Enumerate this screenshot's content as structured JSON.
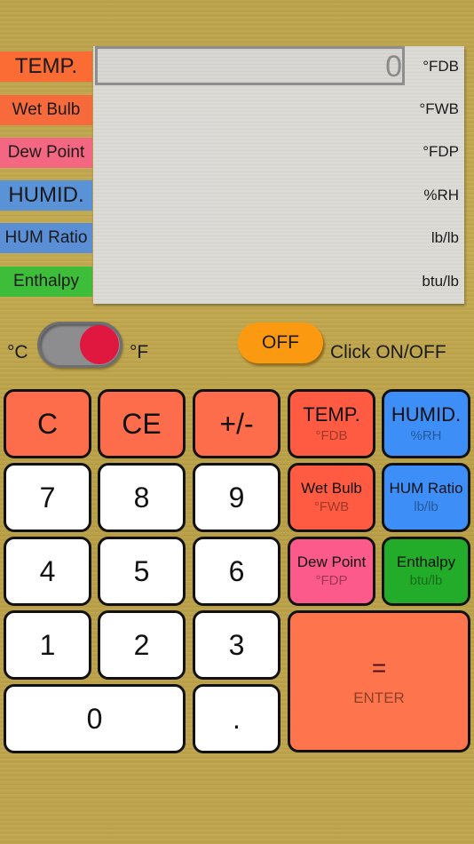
{
  "labels": [
    {
      "text": "TEMP.",
      "color": "#fb6b34"
    },
    {
      "text": "Wet Bulb",
      "color": "#f66a3c"
    },
    {
      "text": "Dew Point",
      "color": "#f46782"
    },
    {
      "text": "HUMID.",
      "color": "#5a92d8"
    },
    {
      "text": "HUM Ratio",
      "color": "#5a8fd6"
    },
    {
      "text": "Enthalpy",
      "color": "#3ebd3a"
    }
  ],
  "display": {
    "input_value": "0",
    "units": [
      "°FDB",
      "°FWB",
      "°FDP",
      "%RH",
      "lb/lb",
      "btu/lb"
    ]
  },
  "controls": {
    "celsius_label": "°C",
    "fahrenheit_label": "°F",
    "unit_toggle_state": "F",
    "power_button_label": "OFF",
    "power_hint": "Click ON/OFF"
  },
  "keypad": {
    "clear": "C",
    "clear_entry": "CE",
    "sign": "+/-",
    "digits": [
      "0",
      "1",
      "2",
      "3",
      "4",
      "5",
      "6",
      "7",
      "8",
      "9"
    ],
    "decimal": ".",
    "temp": {
      "label": "TEMP.",
      "unit": "°FDB"
    },
    "humid": {
      "label": "HUMID.",
      "unit": "%RH"
    },
    "wet_bulb": {
      "label": "Wet Bulb",
      "unit": "°FWB"
    },
    "hum_ratio": {
      "label": "HUM Ratio",
      "unit": "lb/lb"
    },
    "dew_point": {
      "label": "Dew Point",
      "unit": "°FDP"
    },
    "enthalpy": {
      "label": "Enthalpy",
      "unit": "btu/lb"
    },
    "equals": "=",
    "enter": "ENTER"
  }
}
